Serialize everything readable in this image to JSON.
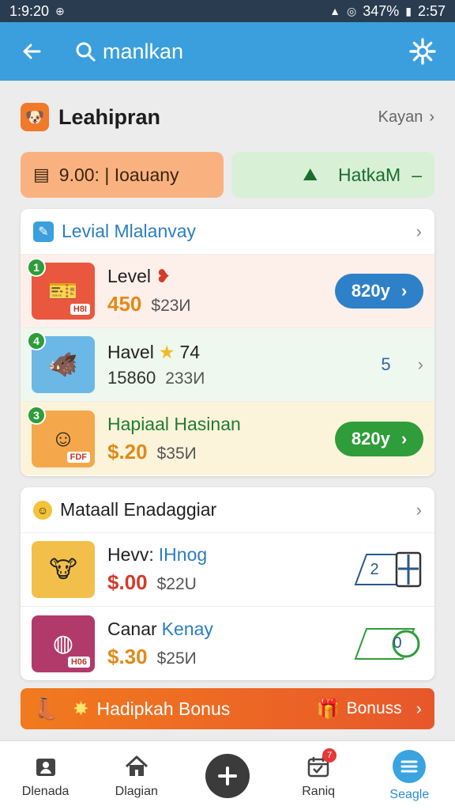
{
  "status_bar": {
    "time": "1:9:20",
    "battery": "347%",
    "clock_right": "2:57"
  },
  "app_bar": {
    "search_text": "manlkan",
    "icons": [
      "back-arrow-icon",
      "search-icon",
      "gear-icon"
    ]
  },
  "section": {
    "title": "Leahipran",
    "link_label": "Kayan"
  },
  "chips": {
    "left_label": "9.00: | Ioauany",
    "right_label": "HatkaM",
    "right_suffix": "–"
  },
  "card1": {
    "title": "Levial Mlalanvay",
    "rows": [
      {
        "name": "Level",
        "price": "450",
        "old_price": "$23И",
        "badge": "1",
        "tag": "H8I",
        "action_label": "820y"
      },
      {
        "name": "Havel",
        "name_suffix": "74",
        "price": "15860",
        "old_price": "233И",
        "badge": "4",
        "value": "5"
      },
      {
        "name": "Hapiaal Hasinan",
        "price": "$.20",
        "old_price": "$35И",
        "badge": "3",
        "tag": "FDF",
        "action_label": "820y"
      }
    ]
  },
  "card2": {
    "title": "Mataall Enadaggiar",
    "rows": [
      {
        "name": "Hevv: ",
        "name_accent": "IHnog",
        "price": "$.00",
        "old_price": "$22U",
        "ticket_label": "2"
      },
      {
        "name": "Canar ",
        "name_accent": "Kenay",
        "price": "$.30",
        "old_price": "$25И",
        "tag": "H06",
        "ticket_label": "0"
      }
    ]
  },
  "bonus": {
    "label": "Hadipkah Bonus",
    "label2": "Bonuss"
  },
  "bottom_nav": [
    {
      "label": "Dlenada",
      "icon": "profile-icon"
    },
    {
      "label": "Dlagian",
      "icon": "home-icon"
    },
    {
      "label": "",
      "icon": "add-icon"
    },
    {
      "label": "Raniq",
      "icon": "calendar-icon",
      "badge": "7"
    },
    {
      "label": "Seagle",
      "icon": "menu-icon",
      "active": true
    }
  ],
  "colors": {
    "app_bar": "#3a9fdc",
    "status_bar": "#2a3c50",
    "orange_chip": "#f9b27f",
    "green_chip": "#d8f0d6",
    "pill_blue": "#2e80c8",
    "pill_green": "#2e9d3a",
    "bonus_bar": "#f17a1e"
  }
}
